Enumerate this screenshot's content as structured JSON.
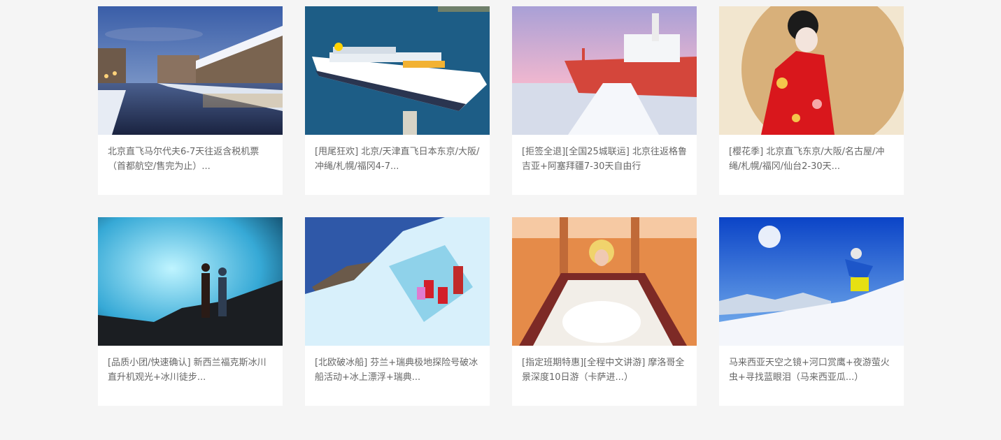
{
  "cards": [
    {
      "title": "北京直飞马尔代夫6-7天往返含税机票（首都航空/售完为止）...",
      "image": "winter-canal-town-photo"
    },
    {
      "title": "[甩尾狂欢] 北京/天津直飞日本东京/大阪/冲绳/札幌/福冈4-7...",
      "image": "cruise-ship-photo"
    },
    {
      "title": "[拒签全退][全国25城联运] 北京往返格鲁吉亚+阿塞拜疆7-30天自由行",
      "image": "icebreaker-ship-photo"
    },
    {
      "title": "[樱花季] 北京直飞东京/大阪/名古屋/冲绳/札幌/福冈/仙台2-30天...",
      "image": "kimono-woman-photo"
    },
    {
      "title": "[品质小团/快速确认] 新西兰福克斯冰川直升机观光+冰川徒步...",
      "image": "glacier-ice-cave-photo"
    },
    {
      "title": "[北欧破冰船] 芬兰+瑞典极地探险号破冰船活动+冰上漂浮+瑞典...",
      "image": "glacier-hikers-photo"
    },
    {
      "title": "[指定班期特惠][全程中文讲游] 摩洛哥全景深度10日游（卡萨进...）",
      "image": "desert-camp-woman-photo"
    },
    {
      "title": "马来西亚天空之镜+河口赏鹰+夜游萤火虫+寻找蓝眼泪（马来西亚瓜...）",
      "image": "skier-photo"
    }
  ]
}
